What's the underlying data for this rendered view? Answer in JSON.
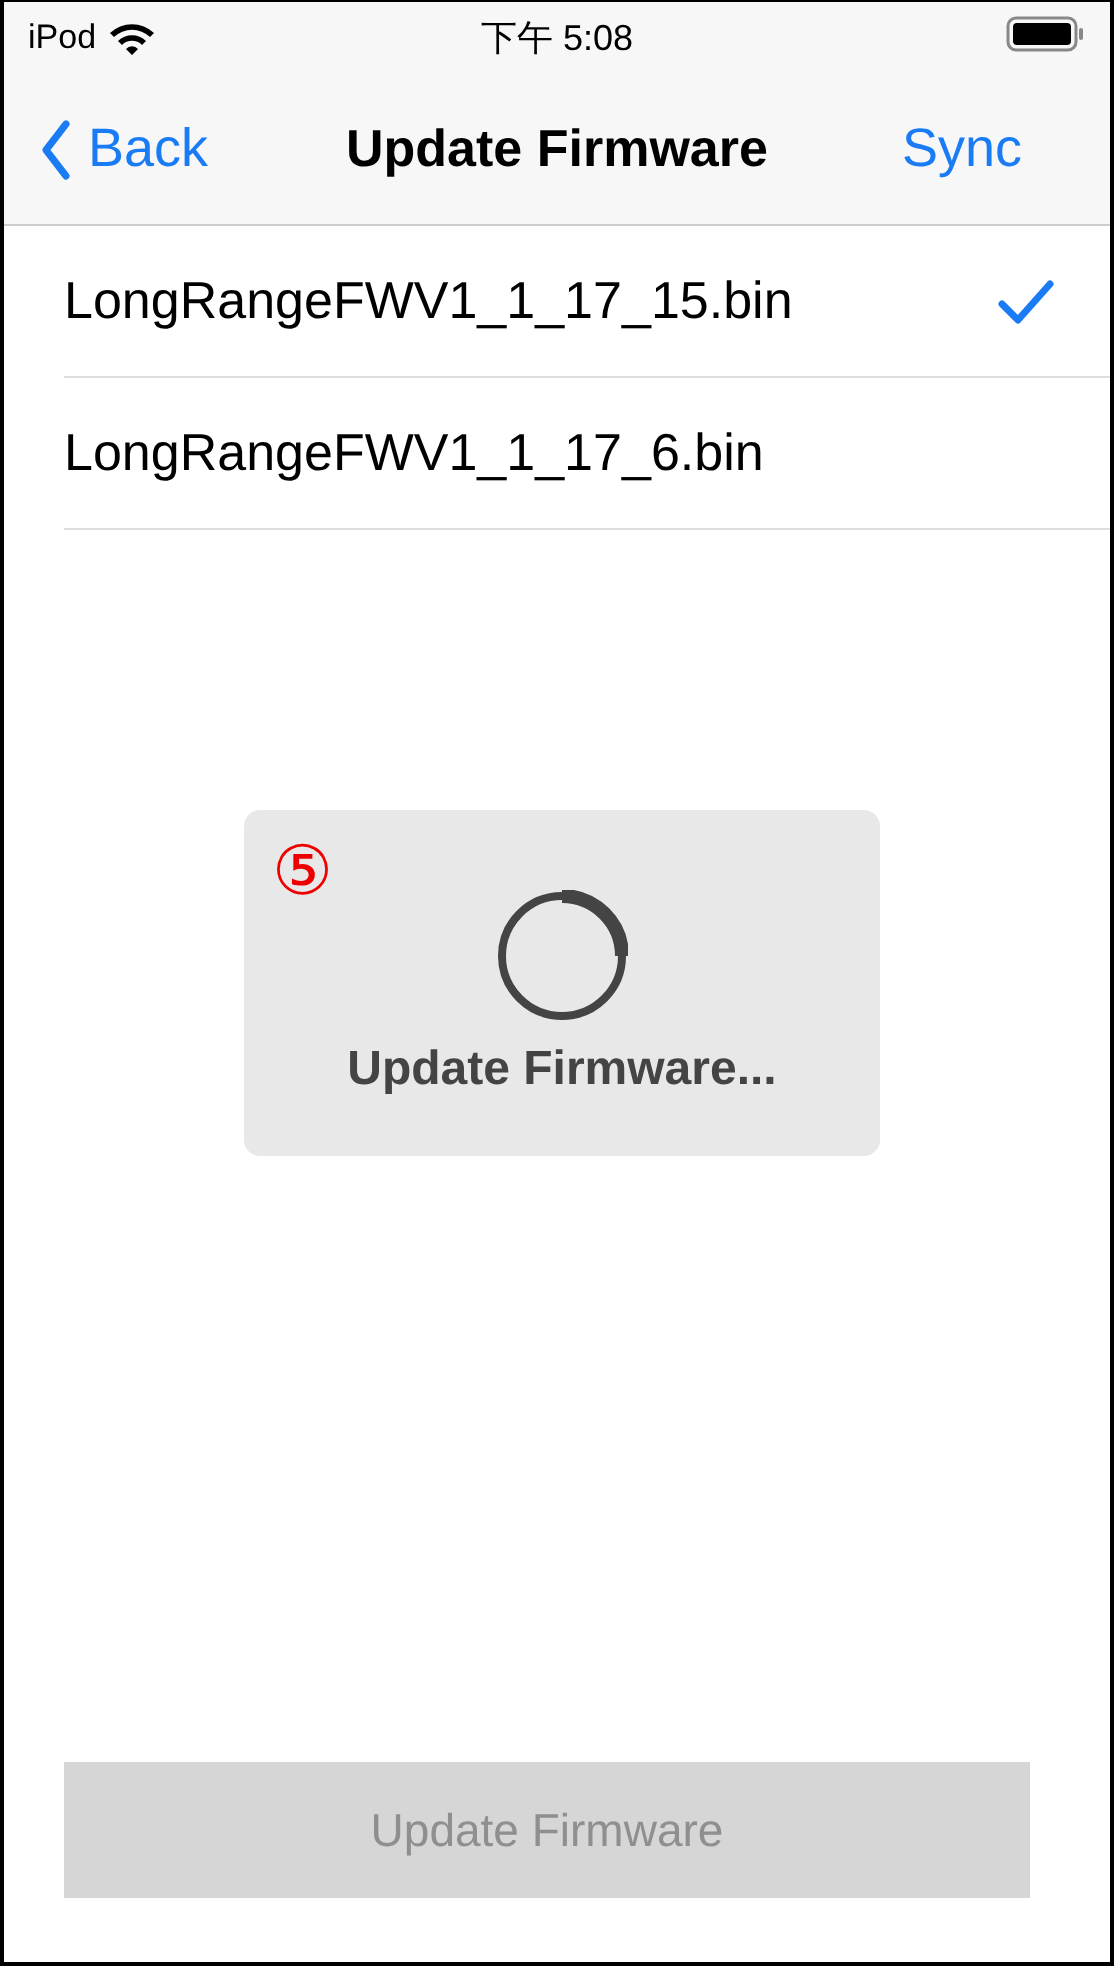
{
  "status_bar": {
    "carrier": "iPod",
    "time": "下午 5:08"
  },
  "nav_bar": {
    "back": "Back",
    "title": "Update Firmware",
    "action": "Sync"
  },
  "files": [
    {
      "name": "LongRangeFWV1_1_17_15.bin",
      "selected": true
    },
    {
      "name": "LongRangeFWV1_1_17_6.bin",
      "selected": false
    }
  ],
  "progress_hud": {
    "step_marker": "⑤",
    "message": "Update Firmware..."
  },
  "update_button": {
    "label": "Update Firmware",
    "disabled": true
  }
}
